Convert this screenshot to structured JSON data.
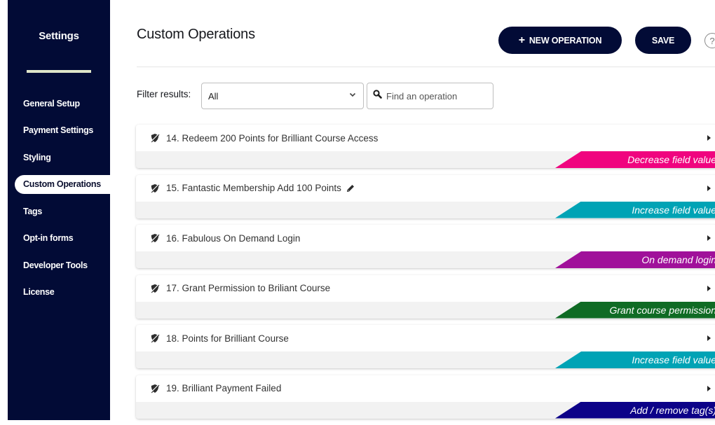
{
  "sidebar": {
    "title": "Settings",
    "items": [
      {
        "label": "General Setup",
        "active": false
      },
      {
        "label": "Payment Settings",
        "active": false
      },
      {
        "label": "Styling",
        "active": false
      },
      {
        "label": "Custom Operations",
        "active": true
      },
      {
        "label": "Tags",
        "active": false
      },
      {
        "label": "Opt-in forms",
        "active": false
      },
      {
        "label": "Developer Tools",
        "active": false
      },
      {
        "label": "License",
        "active": false
      }
    ]
  },
  "header": {
    "title": "Custom Operations",
    "new_operation_label": "NEW OPERATION",
    "new_operation_icon": "+",
    "save_label": "SAVE",
    "help_icon": "?"
  },
  "filter": {
    "label": "Filter results:",
    "selected": "All",
    "search_placeholder": "Find an operation",
    "search_value": ""
  },
  "operations": [
    {
      "title": "14. Redeem 200 Points for Brilliant Course Access",
      "type": "Decrease field value",
      "color": "#f0047f",
      "editable": false
    },
    {
      "title": "15. Fantastic Membership Add 100 Points",
      "type": "Increase field value",
      "color": "#00a3b5",
      "editable": true
    },
    {
      "title": "16. Fabulous On Demand Login",
      "type": "On demand login",
      "color": "#a0119a",
      "editable": false
    },
    {
      "title": "17. Grant Permission to Briliant Course",
      "type": "Grant course permission",
      "color": "#0f6b24",
      "editable": false
    },
    {
      "title": "18. Points for Brilliant Course",
      "type": "Increase field value",
      "color": "#00a3b5",
      "editable": false
    },
    {
      "title": "19. Brilliant Payment Failed",
      "type": "Add / remove tag(s)",
      "color": "#0c0288",
      "editable": false
    }
  ]
}
